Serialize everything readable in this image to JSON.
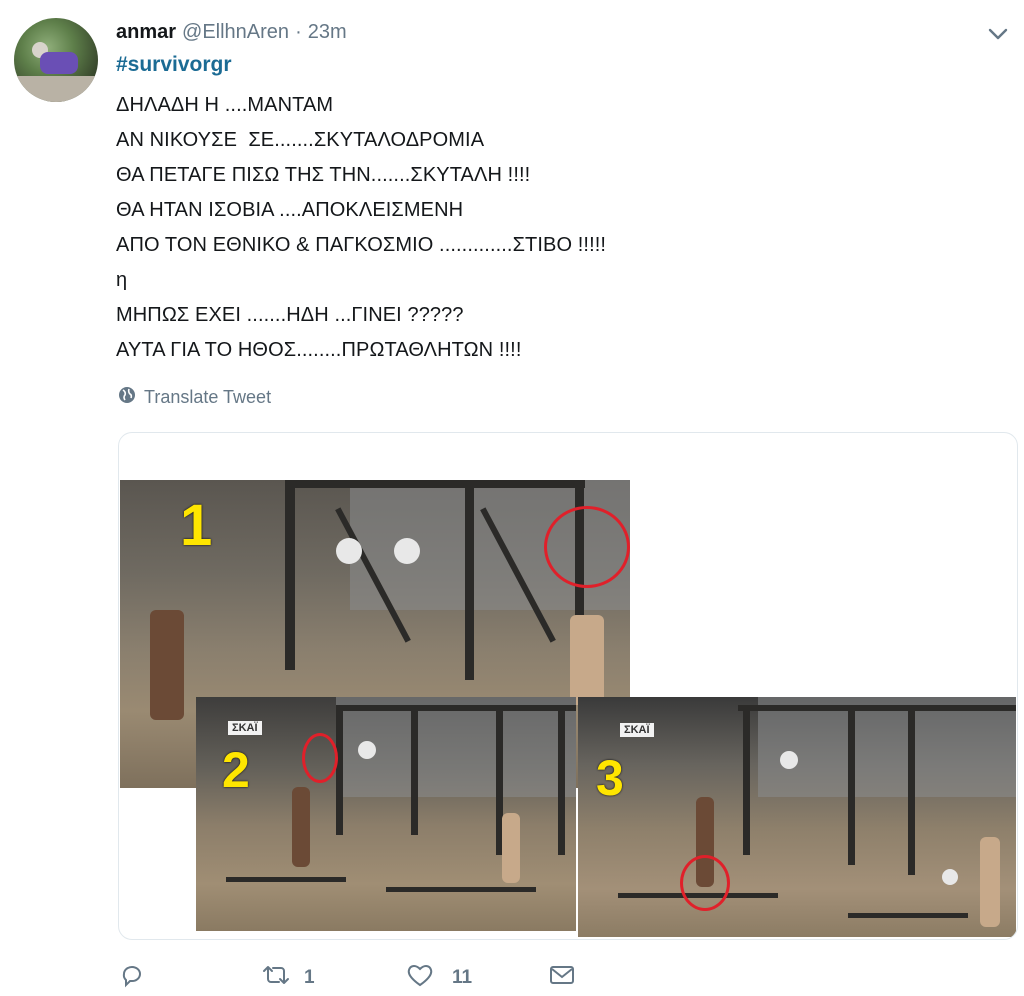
{
  "author": {
    "name": "anmar",
    "handle": "@EllhnAren",
    "separator": "·",
    "time": "23m"
  },
  "tweet": {
    "hashtag": "#survivorgr",
    "lines": [
      "ΔΗΛΑΔΗ Η ....ΜΑΝΤΑΜ",
      "ΑΝ ΝΙΚΟΥΣΕ  ΣΕ.......ΣΚΥΤΑΛΟΔΡΟΜΙΑ",
      "ΘΑ ΠΕΤΑΓΕ ΠΙΣΩ ΤΗΣ ΤΗΝ.......ΣΚΥΤΑΛΗ !!!!",
      "ΘΑ ΗΤΑΝ ΙΣΟΒΙΑ ....ΑΠΟΚΛΕΙΣΜΕΝΗ",
      "ΑΠΟ ΤΟΝ ΕΘΝΙΚΟ & ΠΑΓΚΟΣΜΙΟ .............ΣΤΙΒΟ !!!!!",
      "η",
      "ΜΗΠΩΣ ΕΧΕΙ .......ΗΔΗ ...ΓΙΝΕΙ ?????",
      "ΑΥΤΑ ΓΙΑ ΤΟ ΗΘΟΣ........ΠΡΩΤΑΘΛΗΤΩΝ !!!!"
    ],
    "translate_label": "Translate Tweet"
  },
  "media": {
    "panels": [
      {
        "number": "1"
      },
      {
        "number": "2",
        "badge": "ΣΚΑΪ"
      },
      {
        "number": "3",
        "badge": "ΣΚΑΪ"
      }
    ]
  },
  "actions": {
    "reply_count": "",
    "retweet_count": "1",
    "like_count": "11"
  },
  "icons": {
    "reply": "reply-icon",
    "retweet": "retweet-icon",
    "like": "heart-icon",
    "dm": "envelope-icon",
    "globe": "globe-icon",
    "menu": "chevron-down-icon"
  },
  "colors": {
    "hashtag": "#1b6b94",
    "secondary_text": "#657786",
    "highlight_circle": "#e0202a",
    "number_yellow": "#ffe600"
  }
}
